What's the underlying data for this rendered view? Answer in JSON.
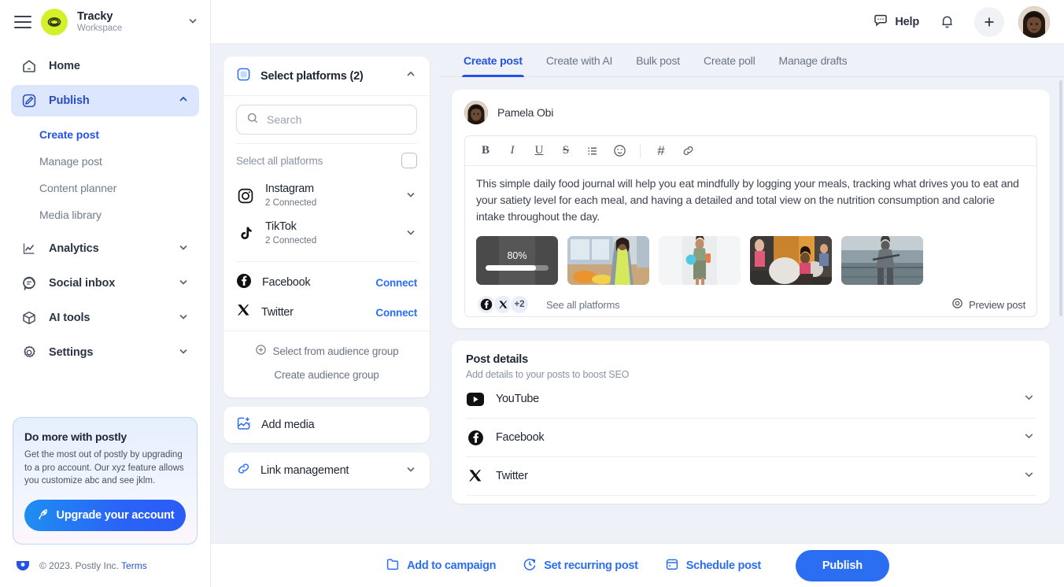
{
  "sidebar": {
    "workspace": {
      "name": "Tracky",
      "subtitle": "Workspace",
      "menu_icon": "hamburger-icon",
      "chevron": "chevron-down-icon"
    },
    "home": {
      "label": "Home",
      "icon": "home-icon"
    },
    "publish": {
      "label": "Publish",
      "icon": "pencil-square-icon",
      "chevron": "chevron-up-icon"
    },
    "publish_children": [
      {
        "label": "Create post",
        "active": true
      },
      {
        "label": "Manage post",
        "active": false
      },
      {
        "label": "Content planner",
        "active": false
      },
      {
        "label": "Media library",
        "active": false
      }
    ],
    "groups": [
      {
        "label": "Analytics",
        "icon": "chart-line-icon",
        "chevron": "chevron-down-icon"
      },
      {
        "label": "Social inbox",
        "icon": "chat-bubble-icon",
        "chevron": "chevron-down-icon"
      },
      {
        "label": "AI tools",
        "icon": "cube-icon",
        "chevron": "chevron-down-icon"
      },
      {
        "label": "Settings",
        "icon": "gear-icon",
        "chevron": "chevron-down-icon"
      }
    ],
    "promo": {
      "title": "Do more with postly",
      "body": "Get the most out of postly by upgrading to a pro account. Our xyz feature allows you customize abc and see jklm.",
      "button": "Upgrade your account",
      "button_icon": "rocket-icon"
    },
    "footer": {
      "copyright": "© 2023. Postly Inc.",
      "terms": "Terms",
      "logo": "postly-logo-icon"
    }
  },
  "topbar": {
    "help": "Help",
    "help_icon": "help-chat-icon",
    "bell_icon": "bell-icon",
    "plus_icon": "plus-icon",
    "avatar": "user-avatar"
  },
  "platforms_panel": {
    "header": "Select platforms (2)",
    "header_icon": "platforms-icon",
    "chevron": "chevron-up-icon",
    "search_placeholder": "Search",
    "search_value": "",
    "search_icon": "search-icon",
    "select_all": "Select all platforms",
    "connected": [
      {
        "name": "Instagram",
        "status": "2 Connected",
        "icon": "instagram-icon",
        "chevron": "chevron-down-icon"
      },
      {
        "name": "TikTok",
        "status": "2 Connected",
        "icon": "tiktok-icon",
        "chevron": "chevron-down-icon"
      }
    ],
    "unconnected": [
      {
        "name": "Facebook",
        "action": "Connect",
        "icon": "facebook-icon"
      },
      {
        "name": "Twitter",
        "action": "Connect",
        "icon": "twitter-x-icon"
      }
    ],
    "select_audience": "Select from audience group",
    "select_audience_icon": "plus-circle-icon",
    "create_audience": "Create audience group",
    "add_media": {
      "label": "Add media",
      "icon": "add-image-icon"
    },
    "link_management": {
      "label": "Link management",
      "icon": "link-icon",
      "chevron": "chevron-down-icon"
    }
  },
  "main": {
    "tabs": [
      {
        "label": "Create post",
        "active": true
      },
      {
        "label": "Create with AI",
        "active": false
      },
      {
        "label": "Bulk post",
        "active": false
      },
      {
        "label": "Create poll",
        "active": false
      },
      {
        "label": "Manage drafts",
        "active": false
      }
    ],
    "composer": {
      "author": "Pamela Obi",
      "toolbar": [
        {
          "name": "bold-icon",
          "glyph": "B"
        },
        {
          "name": "italic-icon",
          "glyph": "I"
        },
        {
          "name": "underline-icon",
          "glyph": "U"
        },
        {
          "name": "strikethrough-icon",
          "glyph": "S"
        },
        {
          "name": "bullet-list-icon",
          "glyph": "≡"
        },
        {
          "name": "emoji-icon",
          "glyph": "☺"
        },
        {
          "name": "hashtag-icon",
          "glyph": "#"
        },
        {
          "name": "link-icon",
          "glyph": "🔗"
        }
      ],
      "text": "This simple daily food journal will help you eat mindfully by logging your meals, tracking what drives you to eat and your satiety level for each meal, and having a detailed and total view on the nutrition consumption and calorie intake throughout the day.",
      "media": [
        {
          "type": "uploading",
          "progress_label": "80%",
          "progress": 80
        },
        {
          "type": "image",
          "alt": "woman in kitchen with fruit"
        },
        {
          "type": "image",
          "alt": "woman holding ball and mat"
        },
        {
          "type": "image",
          "alt": "women with exercise balls in gym"
        },
        {
          "type": "image",
          "alt": "man walking by the sea"
        }
      ],
      "platform_chips": [
        {
          "icon": "facebook-icon"
        },
        {
          "icon": "twitter-x-icon"
        },
        {
          "label": "+2"
        }
      ],
      "see_all": "See all platforms",
      "preview": "Preview post",
      "preview_icon": "eye-target-icon"
    },
    "post_details": {
      "title": "Post details",
      "subtitle": "Add details to your posts to boost SEO",
      "rows": [
        {
          "name": "YouTube",
          "icon": "youtube-icon",
          "chevron": "chevron-down-icon"
        },
        {
          "name": "Facebook",
          "icon": "facebook-icon",
          "chevron": "chevron-down-icon"
        },
        {
          "name": "Twitter",
          "icon": "twitter-x-icon",
          "chevron": "chevron-down-icon"
        }
      ]
    }
  },
  "bottombar": {
    "add_campaign": {
      "label": "Add to campaign",
      "icon": "folder-icon"
    },
    "recurring": {
      "label": "Set recurring post",
      "icon": "clock-refresh-icon"
    },
    "schedule": {
      "label": "Schedule post",
      "icon": "calendar-icon"
    },
    "publish": "Publish"
  },
  "colors": {
    "accent_blue": "#2c6ef2",
    "active_nav_bg": "#dce7fd",
    "active_nav_text": "#2b4dbd",
    "page_bg": "#eef1f8",
    "brand_lime": "#d4f02a"
  }
}
